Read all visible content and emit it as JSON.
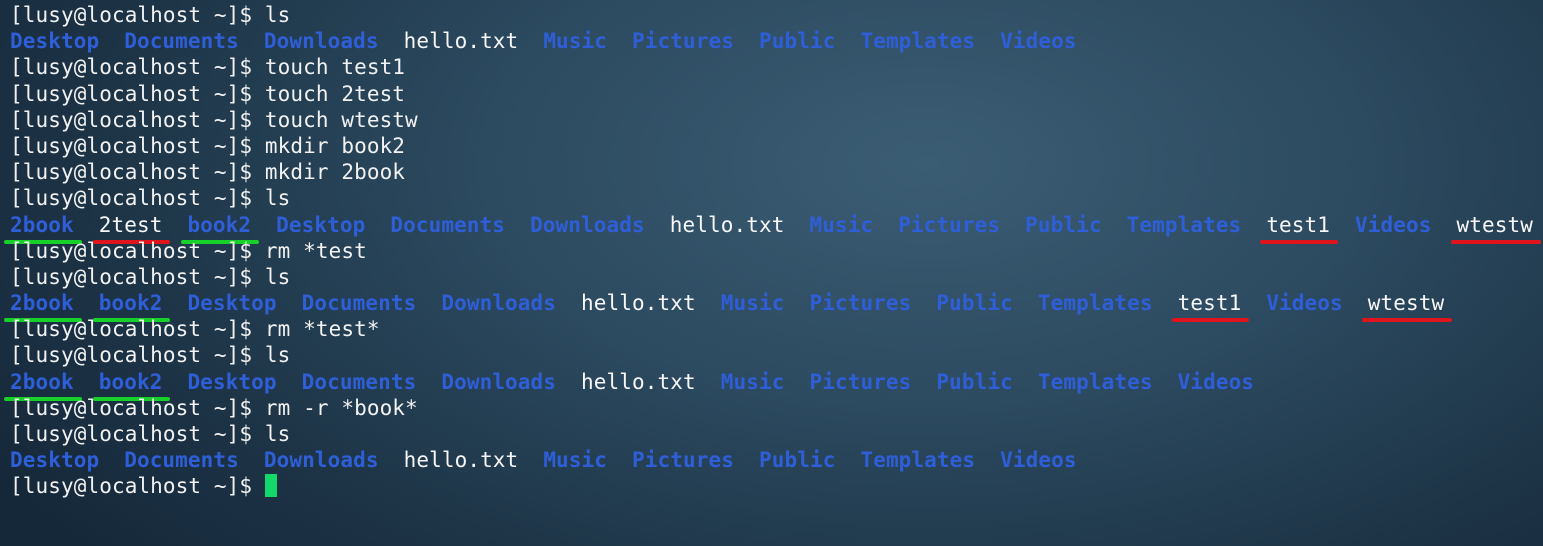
{
  "prompt": "[lusy@localhost ~]$ ",
  "lines": [
    {
      "type": "cmd",
      "command": "ls"
    },
    {
      "type": "ls",
      "entries": [
        {
          "name": "Desktop",
          "kind": "dir",
          "mark": null
        },
        {
          "name": "Documents",
          "kind": "dir",
          "mark": null
        },
        {
          "name": "Downloads",
          "kind": "dir",
          "mark": null
        },
        {
          "name": "hello.txt",
          "kind": "file",
          "mark": null
        },
        {
          "name": "Music",
          "kind": "dir",
          "mark": null
        },
        {
          "name": "Pictures",
          "kind": "dir",
          "mark": null
        },
        {
          "name": "Public",
          "kind": "dir",
          "mark": null
        },
        {
          "name": "Templates",
          "kind": "dir",
          "mark": null
        },
        {
          "name": "Videos",
          "kind": "dir",
          "mark": null
        }
      ]
    },
    {
      "type": "cmd",
      "command": "touch test1"
    },
    {
      "type": "cmd",
      "command": "touch 2test"
    },
    {
      "type": "cmd",
      "command": "touch wtestw"
    },
    {
      "type": "cmd",
      "command": "mkdir book2"
    },
    {
      "type": "cmd",
      "command": "mkdir 2book"
    },
    {
      "type": "cmd",
      "command": "ls"
    },
    {
      "type": "ls",
      "entries": [
        {
          "name": "2book",
          "kind": "dir",
          "mark": "green"
        },
        {
          "name": "2test",
          "kind": "file",
          "mark": "red"
        },
        {
          "name": "book2",
          "kind": "dir",
          "mark": "green"
        },
        {
          "name": "Desktop",
          "kind": "dir",
          "mark": null
        },
        {
          "name": "Documents",
          "kind": "dir",
          "mark": null
        },
        {
          "name": "Downloads",
          "kind": "dir",
          "mark": null
        },
        {
          "name": "hello.txt",
          "kind": "file",
          "mark": null
        },
        {
          "name": "Music",
          "kind": "dir",
          "mark": null
        },
        {
          "name": "Pictures",
          "kind": "dir",
          "mark": null
        },
        {
          "name": "Public",
          "kind": "dir",
          "mark": null
        },
        {
          "name": "Templates",
          "kind": "dir",
          "mark": null
        },
        {
          "name": "test1",
          "kind": "file",
          "mark": "red"
        },
        {
          "name": "Videos",
          "kind": "dir",
          "mark": null
        },
        {
          "name": "wtestw",
          "kind": "file",
          "mark": "red"
        }
      ]
    },
    {
      "type": "cmd",
      "command": "rm *test"
    },
    {
      "type": "cmd",
      "command": "ls"
    },
    {
      "type": "ls",
      "entries": [
        {
          "name": "2book",
          "kind": "dir",
          "mark": "green"
        },
        {
          "name": "book2",
          "kind": "dir",
          "mark": "green"
        },
        {
          "name": "Desktop",
          "kind": "dir",
          "mark": null
        },
        {
          "name": "Documents",
          "kind": "dir",
          "mark": null
        },
        {
          "name": "Downloads",
          "kind": "dir",
          "mark": null
        },
        {
          "name": "hello.txt",
          "kind": "file",
          "mark": null
        },
        {
          "name": "Music",
          "kind": "dir",
          "mark": null
        },
        {
          "name": "Pictures",
          "kind": "dir",
          "mark": null
        },
        {
          "name": "Public",
          "kind": "dir",
          "mark": null
        },
        {
          "name": "Templates",
          "kind": "dir",
          "mark": null
        },
        {
          "name": "test1",
          "kind": "file",
          "mark": "red"
        },
        {
          "name": "Videos",
          "kind": "dir",
          "mark": null
        },
        {
          "name": "wtestw",
          "kind": "file",
          "mark": "red"
        }
      ]
    },
    {
      "type": "cmd",
      "command": "rm *test*"
    },
    {
      "type": "cmd",
      "command": "ls"
    },
    {
      "type": "ls",
      "entries": [
        {
          "name": "2book",
          "kind": "dir",
          "mark": "green"
        },
        {
          "name": "book2",
          "kind": "dir",
          "mark": "green"
        },
        {
          "name": "Desktop",
          "kind": "dir",
          "mark": null
        },
        {
          "name": "Documents",
          "kind": "dir",
          "mark": null
        },
        {
          "name": "Downloads",
          "kind": "dir",
          "mark": null
        },
        {
          "name": "hello.txt",
          "kind": "file",
          "mark": null
        },
        {
          "name": "Music",
          "kind": "dir",
          "mark": null
        },
        {
          "name": "Pictures",
          "kind": "dir",
          "mark": null
        },
        {
          "name": "Public",
          "kind": "dir",
          "mark": null
        },
        {
          "name": "Templates",
          "kind": "dir",
          "mark": null
        },
        {
          "name": "Videos",
          "kind": "dir",
          "mark": null
        }
      ]
    },
    {
      "type": "cmd",
      "command": "rm -r *book*"
    },
    {
      "type": "cmd",
      "command": "ls"
    },
    {
      "type": "ls",
      "entries": [
        {
          "name": "Desktop",
          "kind": "dir",
          "mark": null
        },
        {
          "name": "Documents",
          "kind": "dir",
          "mark": null
        },
        {
          "name": "Downloads",
          "kind": "dir",
          "mark": null
        },
        {
          "name": "hello.txt",
          "kind": "file",
          "mark": null
        },
        {
          "name": "Music",
          "kind": "dir",
          "mark": null
        },
        {
          "name": "Pictures",
          "kind": "dir",
          "mark": null
        },
        {
          "name": "Public",
          "kind": "dir",
          "mark": null
        },
        {
          "name": "Templates",
          "kind": "dir",
          "mark": null
        },
        {
          "name": "Videos",
          "kind": "dir",
          "mark": null
        }
      ]
    },
    {
      "type": "cmd",
      "command": "",
      "cursor": true
    }
  ],
  "colors": {
    "directory": "#2f5fd8",
    "file": "#f7f7f7",
    "prompt_text": "#f2f2f2",
    "cursor": "#13d86a",
    "annotation_green": "#17d12a",
    "annotation_red": "#e0141c"
  }
}
